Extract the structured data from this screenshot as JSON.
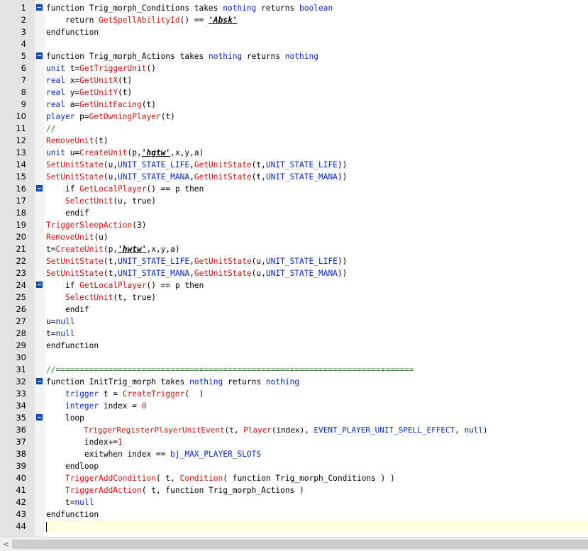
{
  "scrollbar": {
    "left_arrow": "<"
  },
  "lines": [
    {
      "n": "1",
      "fold": true,
      "indent": "",
      "tokens": [
        [
          "kw",
          "function Trig_morph_Conditions takes "
        ],
        [
          "ty",
          "nothing"
        ],
        [
          "kw",
          " returns "
        ],
        [
          "ty",
          "boolean"
        ]
      ]
    },
    {
      "n": "2",
      "fold": false,
      "indent": "    ",
      "tokens": [
        [
          "kw",
          "return "
        ],
        [
          "fn",
          "GetSpellAbilityId"
        ],
        [
          "op",
          "() == "
        ],
        [
          "st",
          "'Absk'"
        ]
      ]
    },
    {
      "n": "3",
      "fold": false,
      "indent": "",
      "tokens": [
        [
          "kw",
          "endfunction"
        ]
      ]
    },
    {
      "n": "4",
      "fold": false,
      "indent": "",
      "tokens": []
    },
    {
      "n": "5",
      "fold": true,
      "indent": "",
      "tokens": [
        [
          "kw",
          "function Trig_morph_Actions takes "
        ],
        [
          "ty",
          "nothing"
        ],
        [
          "kw",
          " returns "
        ],
        [
          "ty",
          "nothing"
        ]
      ]
    },
    {
      "n": "6",
      "fold": false,
      "indent": "",
      "tokens": [
        [
          "ty",
          "unit"
        ],
        [
          "op",
          " t="
        ],
        [
          "fn",
          "GetTriggerUnit"
        ],
        [
          "op",
          "()"
        ]
      ]
    },
    {
      "n": "7",
      "fold": false,
      "indent": "",
      "tokens": [
        [
          "ty",
          "real"
        ],
        [
          "op",
          " x="
        ],
        [
          "fn",
          "GetUnitX"
        ],
        [
          "op",
          "(t)"
        ]
      ]
    },
    {
      "n": "8",
      "fold": false,
      "indent": "",
      "tokens": [
        [
          "ty",
          "real"
        ],
        [
          "op",
          " y="
        ],
        [
          "fn",
          "GetUnitY"
        ],
        [
          "op",
          "(t)"
        ]
      ]
    },
    {
      "n": "9",
      "fold": false,
      "indent": "",
      "tokens": [
        [
          "ty",
          "real"
        ],
        [
          "op",
          " a="
        ],
        [
          "fn",
          "GetUnitFacing"
        ],
        [
          "op",
          "(t)"
        ]
      ]
    },
    {
      "n": "10",
      "fold": false,
      "indent": "",
      "tokens": [
        [
          "ty",
          "player"
        ],
        [
          "op",
          " p="
        ],
        [
          "fn",
          "GetOwningPlayer"
        ],
        [
          "op",
          "(t)"
        ]
      ]
    },
    {
      "n": "11",
      "fold": false,
      "indent": "",
      "tokens": [
        [
          "cm",
          "//"
        ]
      ]
    },
    {
      "n": "12",
      "fold": false,
      "indent": "",
      "tokens": [
        [
          "fn",
          "RemoveUnit"
        ],
        [
          "op",
          "(t)"
        ]
      ]
    },
    {
      "n": "13",
      "fold": false,
      "indent": "",
      "tokens": [
        [
          "ty",
          "unit"
        ],
        [
          "op",
          " u="
        ],
        [
          "fn",
          "CreateUnit"
        ],
        [
          "op",
          "(p,"
        ],
        [
          "st",
          "'hgtw'"
        ],
        [
          "op",
          ",x,y,a)"
        ]
      ]
    },
    {
      "n": "14",
      "fold": false,
      "indent": "",
      "tokens": [
        [
          "fn",
          "SetUnitState"
        ],
        [
          "op",
          "(u,"
        ],
        [
          "cs",
          "UNIT_STATE_LIFE"
        ],
        [
          "op",
          ","
        ],
        [
          "fn",
          "GetUnitState"
        ],
        [
          "op",
          "(t,"
        ],
        [
          "cs",
          "UNIT_STATE_LIFE"
        ],
        [
          "op",
          "))"
        ]
      ]
    },
    {
      "n": "15",
      "fold": false,
      "indent": "",
      "tokens": [
        [
          "fn",
          "SetUnitState"
        ],
        [
          "op",
          "(u,"
        ],
        [
          "cs",
          "UNIT_STATE_MANA"
        ],
        [
          "op",
          ","
        ],
        [
          "fn",
          "GetUnitState"
        ],
        [
          "op",
          "(t,"
        ],
        [
          "cs",
          "UNIT_STATE_MANA"
        ],
        [
          "op",
          "))"
        ]
      ]
    },
    {
      "n": "16",
      "fold": true,
      "indent": "    ",
      "tokens": [
        [
          "kw",
          "if "
        ],
        [
          "fn",
          "GetLocalPlayer"
        ],
        [
          "op",
          "() == p "
        ],
        [
          "kw",
          "then"
        ]
      ]
    },
    {
      "n": "17",
      "fold": false,
      "indent": "    ",
      "tokens": [
        [
          "fn",
          "SelectUnit"
        ],
        [
          "op",
          "(u, "
        ],
        [
          "kw",
          "true"
        ],
        [
          "op",
          ")"
        ]
      ]
    },
    {
      "n": "18",
      "fold": false,
      "indent": "    ",
      "tokens": [
        [
          "kw",
          "endif"
        ]
      ]
    },
    {
      "n": "19",
      "fold": false,
      "indent": "",
      "tokens": [
        [
          "fn",
          "TriggerSleepAction"
        ],
        [
          "op",
          "(3)"
        ]
      ]
    },
    {
      "n": "20",
      "fold": false,
      "indent": "",
      "tokens": [
        [
          "fn",
          "RemoveUnit"
        ],
        [
          "op",
          "(u)"
        ]
      ]
    },
    {
      "n": "21",
      "fold": false,
      "indent": "",
      "tokens": [
        [
          "op",
          "t="
        ],
        [
          "fn",
          "CreateUnit"
        ],
        [
          "op",
          "(p,"
        ],
        [
          "st",
          "'hwtw'"
        ],
        [
          "op",
          ",x,y,a)"
        ]
      ]
    },
    {
      "n": "22",
      "fold": false,
      "indent": "",
      "tokens": [
        [
          "fn",
          "SetUnitState"
        ],
        [
          "op",
          "(t,"
        ],
        [
          "cs",
          "UNIT_STATE_LIFE"
        ],
        [
          "op",
          ","
        ],
        [
          "fn",
          "GetUnitState"
        ],
        [
          "op",
          "(u,"
        ],
        [
          "cs",
          "UNIT_STATE_LIFE"
        ],
        [
          "op",
          "))"
        ]
      ]
    },
    {
      "n": "23",
      "fold": false,
      "indent": "",
      "tokens": [
        [
          "fn",
          "SetUnitState"
        ],
        [
          "op",
          "(t,"
        ],
        [
          "cs",
          "UNIT_STATE_MANA"
        ],
        [
          "op",
          ","
        ],
        [
          "fn",
          "GetUnitState"
        ],
        [
          "op",
          "(u,"
        ],
        [
          "cs",
          "UNIT_STATE_MANA"
        ],
        [
          "op",
          "))"
        ]
      ]
    },
    {
      "n": "24",
      "fold": true,
      "indent": "    ",
      "tokens": [
        [
          "kw",
          "if "
        ],
        [
          "fn",
          "GetLocalPlayer"
        ],
        [
          "op",
          "() == p "
        ],
        [
          "kw",
          "then"
        ]
      ]
    },
    {
      "n": "25",
      "fold": false,
      "indent": "    ",
      "tokens": [
        [
          "fn",
          "SelectUnit"
        ],
        [
          "op",
          "(t, "
        ],
        [
          "kw",
          "true"
        ],
        [
          "op",
          ")"
        ]
      ]
    },
    {
      "n": "26",
      "fold": false,
      "indent": "    ",
      "tokens": [
        [
          "kw",
          "endif"
        ]
      ]
    },
    {
      "n": "27",
      "fold": false,
      "indent": "",
      "tokens": [
        [
          "op",
          "u="
        ],
        [
          "ty",
          "null"
        ]
      ]
    },
    {
      "n": "28",
      "fold": false,
      "indent": "",
      "tokens": [
        [
          "op",
          "t="
        ],
        [
          "ty",
          "null"
        ]
      ]
    },
    {
      "n": "29",
      "fold": false,
      "indent": "",
      "tokens": [
        [
          "kw",
          "endfunction"
        ]
      ]
    },
    {
      "n": "30",
      "fold": false,
      "indent": "",
      "tokens": []
    },
    {
      "n": "31",
      "fold": false,
      "indent": "",
      "tokens": [
        [
          "cm",
          "//==========================================================================="
        ]
      ]
    },
    {
      "n": "32",
      "fold": true,
      "indent": "",
      "tokens": [
        [
          "kw",
          "function InitTrig_morph takes "
        ],
        [
          "ty",
          "nothing"
        ],
        [
          "kw",
          " returns "
        ],
        [
          "ty",
          "nothing"
        ]
      ]
    },
    {
      "n": "33",
      "fold": false,
      "indent": "    ",
      "tokens": [
        [
          "ty",
          "trigger"
        ],
        [
          "op",
          " t = "
        ],
        [
          "fn",
          "CreateTrigger"
        ],
        [
          "op",
          "(  )"
        ]
      ]
    },
    {
      "n": "34",
      "fold": false,
      "indent": "    ",
      "tokens": [
        [
          "ty",
          "integer"
        ],
        [
          "op",
          " index = "
        ],
        [
          "fn",
          "0"
        ]
      ]
    },
    {
      "n": "35",
      "fold": true,
      "indent": "    ",
      "tokens": [
        [
          "kw",
          "loop"
        ]
      ]
    },
    {
      "n": "36",
      "fold": false,
      "indent": "        ",
      "tight": true,
      "tokens": [
        [
          "fn",
          "TriggerRegisterPlayerUnitEvent"
        ],
        [
          "op",
          "(t, "
        ],
        [
          "fn",
          "Player"
        ],
        [
          "op",
          "(index), "
        ],
        [
          "cs",
          "EVENT_PLAYER_UNIT_SPELL_EFFECT"
        ],
        [
          "op",
          ", "
        ],
        [
          "ty",
          "null"
        ],
        [
          "op",
          ")"
        ]
      ]
    },
    {
      "n": "37",
      "fold": false,
      "indent": "        ",
      "tokens": [
        [
          "op",
          "index+="
        ],
        [
          "fn",
          "1"
        ]
      ]
    },
    {
      "n": "38",
      "fold": false,
      "indent": "        ",
      "tokens": [
        [
          "kw",
          "exitwhen"
        ],
        [
          "op",
          " index == "
        ],
        [
          "cs",
          "bj_MAX_PLAYER_SLOTS"
        ]
      ]
    },
    {
      "n": "39",
      "fold": false,
      "indent": "    ",
      "tokens": [
        [
          "kw",
          "endloop"
        ]
      ]
    },
    {
      "n": "40",
      "fold": false,
      "indent": "    ",
      "tokens": [
        [
          "fn",
          "TriggerAddCondition"
        ],
        [
          "op",
          "( t, "
        ],
        [
          "fn",
          "Condition"
        ],
        [
          "op",
          "( "
        ],
        [
          "kw",
          "function"
        ],
        [
          "op",
          " Trig_morph_Conditions ) )"
        ]
      ]
    },
    {
      "n": "41",
      "fold": false,
      "indent": "    ",
      "tokens": [
        [
          "fn",
          "TriggerAddAction"
        ],
        [
          "op",
          "( t, "
        ],
        [
          "kw",
          "function"
        ],
        [
          "op",
          " Trig_morph_Actions )"
        ]
      ]
    },
    {
      "n": "42",
      "fold": false,
      "indent": "    ",
      "tokens": [
        [
          "op",
          "t="
        ],
        [
          "ty",
          "null"
        ]
      ]
    },
    {
      "n": "43",
      "fold": false,
      "indent": "",
      "tokens": [
        [
          "kw",
          "endfunction"
        ]
      ]
    },
    {
      "n": "44",
      "fold": false,
      "indent": "",
      "current": true,
      "tokens": []
    }
  ]
}
